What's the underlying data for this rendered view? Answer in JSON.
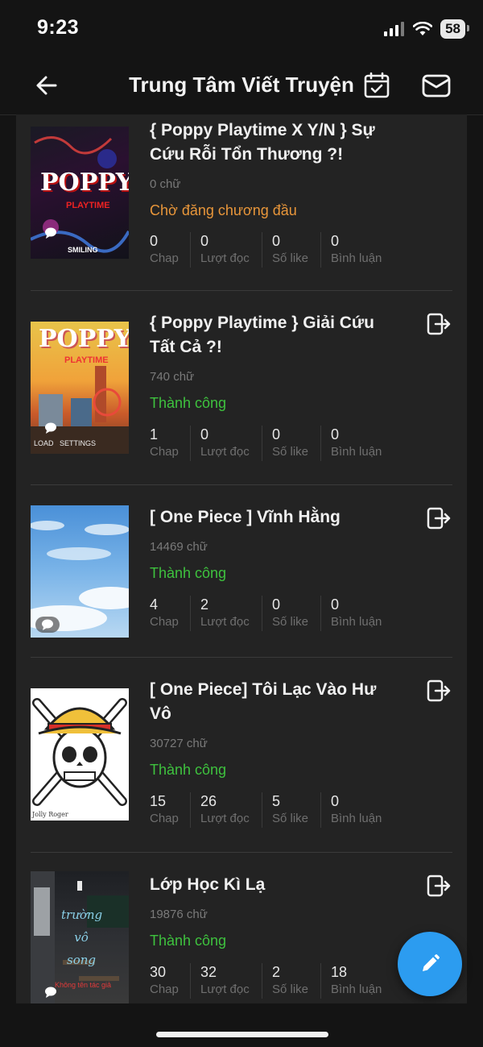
{
  "status_bar": {
    "time": "9:23",
    "battery": "58"
  },
  "header": {
    "title": "Trung Tâm Viết Truyện"
  },
  "icons": {
    "back": "arrow-left-icon",
    "calendar": "calendar-check-icon",
    "mail": "mail-icon",
    "export": "export-icon",
    "comment": "comment-icon",
    "edit": "pencil-icon"
  },
  "colors": {
    "accent": "#2c9cf0",
    "success": "#3ec23e",
    "pending": "#e8963a",
    "background": "#141414",
    "panel": "#232323"
  },
  "stat_labels": {
    "chap": "Chap",
    "views": "Lượt đọc",
    "likes": "Số like",
    "comments": "Bình luận"
  },
  "stories": [
    {
      "title": "{ Poppy Playtime X Y/N } Sự Cứu Rỗi Tổn Thương ?!",
      "words": "0 chữ",
      "status": "Chờ đăng chương đầu",
      "status_type": "pending",
      "chap": "0",
      "views": "0",
      "likes": "0",
      "comments": "0",
      "cover_text": "POPPY",
      "cover_sub": "PLAYTIME",
      "cover_caption": "SMILING"
    },
    {
      "title": "{ Poppy Playtime } Giải Cứu Tất Cả ?!",
      "words": "740 chữ",
      "status": "Thành công",
      "status_type": "ok",
      "chap": "1",
      "views": "0",
      "likes": "0",
      "comments": "0",
      "cover_text": "POPPY",
      "cover_sub": "PLAYTIME",
      "cover_caption": "LOAD   SETTINGS"
    },
    {
      "title": "[ One Piece ] Vĩnh Hằng",
      "words": "14469 chữ",
      "status": "Thành công",
      "status_type": "ok",
      "chap": "4",
      "views": "2",
      "likes": "0",
      "comments": "0"
    },
    {
      "title": "[ One Piece] Tôi Lạc Vào Hư Vô",
      "words": "30727 chữ",
      "status": "Thành công",
      "status_type": "ok",
      "chap": "15",
      "views": "26",
      "likes": "5",
      "comments": "0",
      "cover_caption": "Jolly Roger"
    },
    {
      "title": "Lớp Học Kì Lạ",
      "words": "19876 chữ",
      "status": "Thành công",
      "status_type": "ok",
      "chap": "30",
      "views": "32",
      "likes": "2",
      "comments": "18",
      "cover_text": "trường vô song",
      "cover_caption": "Không tên tác giả"
    }
  ]
}
